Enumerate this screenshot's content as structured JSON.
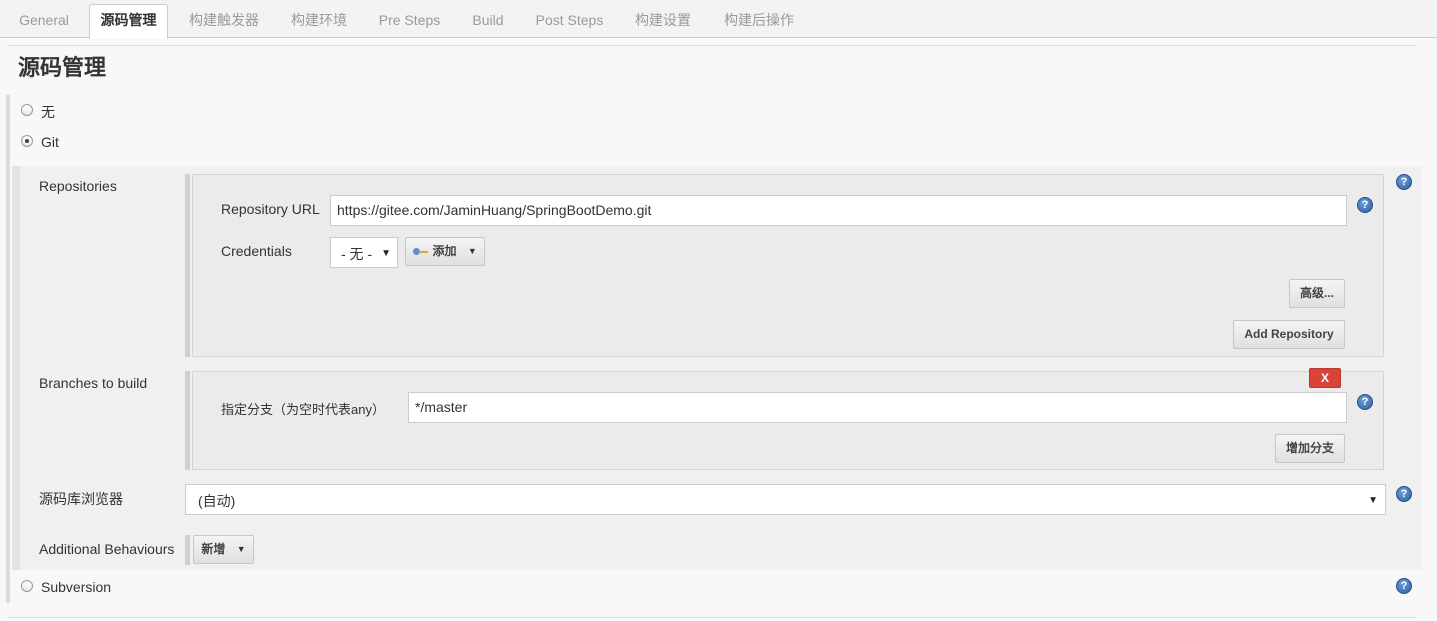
{
  "tabs": [
    {
      "label": "General",
      "active": false
    },
    {
      "label": "源码管理",
      "active": true
    },
    {
      "label": "构建触发器",
      "active": false
    },
    {
      "label": "构建环境",
      "active": false
    },
    {
      "label": "Pre Steps",
      "active": false
    },
    {
      "label": "Build",
      "active": false
    },
    {
      "label": "Post Steps",
      "active": false
    },
    {
      "label": "构建设置",
      "active": false
    },
    {
      "label": "构建后操作",
      "active": false
    }
  ],
  "section": {
    "title": "源码管理"
  },
  "scm_options": {
    "none": {
      "label": "无",
      "checked": false
    },
    "git": {
      "label": "Git",
      "checked": true
    },
    "svn": {
      "label": "Subversion",
      "checked": false
    }
  },
  "repositories": {
    "label": "Repositories",
    "url_label": "Repository URL",
    "url_value": "https://gitee.com/JaminHuang/SpringBootDemo.git",
    "credentials_label": "Credentials",
    "credentials_value": "- 无 -",
    "add_label": "添加",
    "advanced_label": "高级...",
    "add_repo_label": "Add Repository"
  },
  "branches": {
    "label": "Branches to build",
    "delete_label": "X",
    "specifier_label": "指定分支（为空时代表any）",
    "specifier_value": "*/master",
    "add_branch_label": "增加分支"
  },
  "browser": {
    "label": "源码库浏览器",
    "value": "(自动)"
  },
  "behaviours": {
    "label": "Additional Behaviours",
    "add_label": "新增"
  },
  "help_glyph": "?",
  "icons": {
    "help": "help-icon",
    "key": "key-icon",
    "caret": "caret-down-icon"
  },
  "colors": {
    "delete_button": "#d9443a",
    "help_icon": "#2e5f9e"
  }
}
